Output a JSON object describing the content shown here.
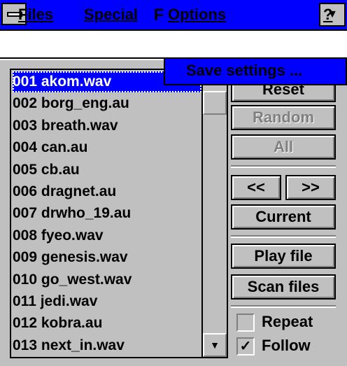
{
  "window": {
    "title": "Files"
  },
  "menubar": {
    "items": [
      {
        "label": "Files",
        "mnemonic": "F"
      },
      {
        "label": "Special",
        "mnemonic": "S"
      },
      {
        "label": "Options",
        "mnemonic": "O"
      },
      {
        "label": "?"
      }
    ]
  },
  "dropdown": {
    "items": [
      {
        "label": "Save settings ..."
      }
    ]
  },
  "files": [
    "001 akom.wav",
    "002 borg_eng.au",
    "003 breath.wav",
    "004 can.au",
    "005 cb.au",
    "006 dragnet.au",
    "007 drwho_19.au",
    "008 fyeo.wav",
    "009 genesis.wav",
    "010 go_west.wav",
    "011 jedi.wav",
    "012 kobra.au",
    "013 next_in.wav"
  ],
  "selected_index": 0,
  "buttons": {
    "reset": "Reset",
    "random": "Random",
    "all": "All",
    "prev": "<<",
    "next": ">>",
    "current": "Current",
    "play": "Play file",
    "scan": "Scan files"
  },
  "checkboxes": {
    "repeat": {
      "label": "Repeat",
      "checked": false
    },
    "follow": {
      "label": "Follow",
      "checked": true,
      "mark": "✓"
    }
  },
  "icons": {
    "dropdown_arrow": "▼",
    "scroll_down": "▼"
  }
}
